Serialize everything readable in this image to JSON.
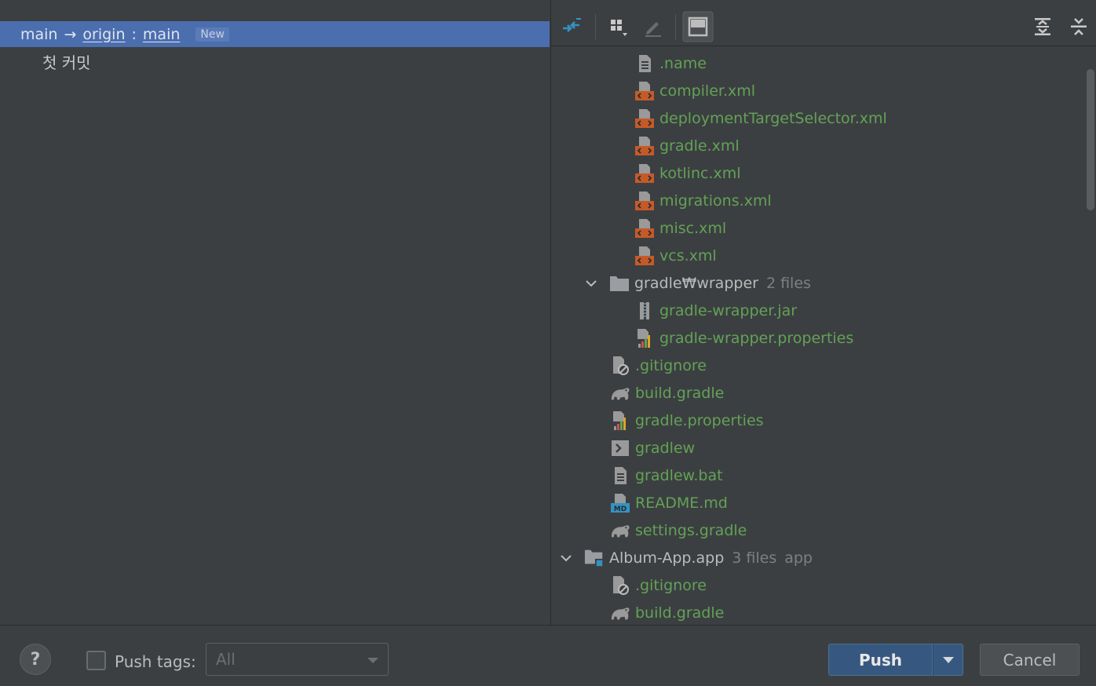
{
  "branch": {
    "local": "main",
    "arrow": "→",
    "remote": "origin",
    "separator": ":",
    "remote_branch": "main",
    "badge": "New"
  },
  "commits": [
    "첫 커밋"
  ],
  "toolbar": {
    "icons": [
      "merge-arrows-icon",
      "group-by-icon",
      "edit-icon",
      "preview-icon",
      "expand-all-icon",
      "collapse-all-icon"
    ]
  },
  "tree": [
    {
      "name": ".name",
      "kind": "text-file",
      "color": "green"
    },
    {
      "name": "compiler.xml",
      "kind": "xml-file",
      "color": "green"
    },
    {
      "name": "deploymentTargetSelector.xml",
      "kind": "xml-file",
      "color": "green"
    },
    {
      "name": "gradle.xml",
      "kind": "xml-file",
      "color": "green"
    },
    {
      "name": "kotlinc.xml",
      "kind": "xml-file",
      "color": "green"
    },
    {
      "name": "migrations.xml",
      "kind": "xml-file",
      "color": "green"
    },
    {
      "name": "misc.xml",
      "kind": "xml-file",
      "color": "green"
    },
    {
      "name": "vcs.xml",
      "kind": "xml-file",
      "color": "green"
    },
    {
      "name": "gradle₩wrapper",
      "kind": "folder",
      "meta": "2 files",
      "color": "gray"
    },
    {
      "name": "gradle-wrapper.jar",
      "kind": "jar-file",
      "color": "green"
    },
    {
      "name": "gradle-wrapper.properties",
      "kind": "properties-file",
      "color": "green"
    },
    {
      "name": ".gitignore",
      "kind": "ignore-file",
      "color": "green"
    },
    {
      "name": "build.gradle",
      "kind": "gradle-file",
      "color": "green"
    },
    {
      "name": "gradle.properties",
      "kind": "properties-file",
      "color": "green"
    },
    {
      "name": "gradlew",
      "kind": "shell-file",
      "color": "green"
    },
    {
      "name": "gradlew.bat",
      "kind": "text-file",
      "color": "green"
    },
    {
      "name": "README.md",
      "kind": "markdown-file",
      "color": "green"
    },
    {
      "name": "settings.gradle",
      "kind": "gradle-file",
      "color": "green"
    },
    {
      "name": "Album-App.app",
      "kind": "module-folder",
      "meta": "3 files",
      "meta2": "app",
      "color": "gray"
    },
    {
      "name": ".gitignore",
      "kind": "ignore-file",
      "color": "green"
    },
    {
      "name": "build.gradle",
      "kind": "gradle-file",
      "color": "green"
    }
  ],
  "footer": {
    "help_label": "?",
    "push_tags_label": "Push tags:",
    "tags_value": "All",
    "push_label": "Push",
    "cancel_label": "Cancel"
  },
  "colors": {
    "selection": "#4b6eaf",
    "added_file": "#62a257",
    "background": "#3c3f41",
    "primary_button": "#365880"
  }
}
